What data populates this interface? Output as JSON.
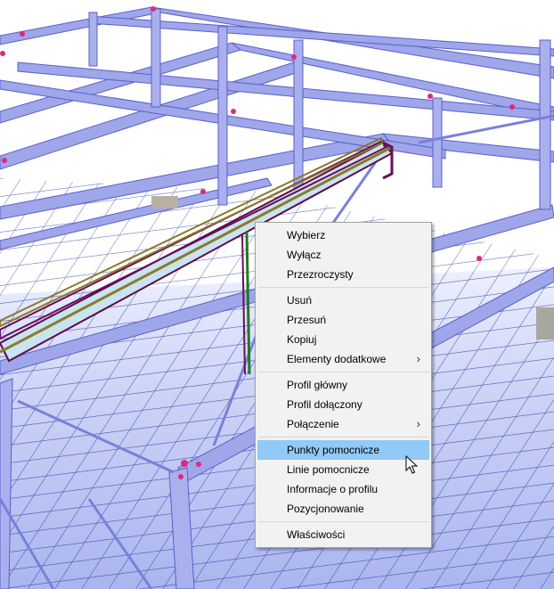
{
  "context_menu": {
    "groups": [
      [
        {
          "label": "Wybierz"
        },
        {
          "label": "Wyłącz"
        },
        {
          "label": "Przezroczysty"
        }
      ],
      [
        {
          "label": "Usuń"
        },
        {
          "label": "Przesuń"
        },
        {
          "label": "Kopiuj"
        },
        {
          "label": "Elementy dodatkowe",
          "submenu": true,
          "arrow": "›"
        }
      ],
      [
        {
          "label": "Profil główny"
        },
        {
          "label": "Profil dołączony"
        },
        {
          "label": "Połączenie",
          "submenu": true,
          "arrow": "›"
        }
      ],
      [
        {
          "label": "Punkty pomocnicze",
          "highlighted": true
        },
        {
          "label": "Linie pomocnicze"
        },
        {
          "label": "Informacje o profilu"
        },
        {
          "label": "Pozycjonowanie"
        }
      ],
      [
        {
          "label": "Właściwości"
        }
      ]
    ]
  },
  "colors": {
    "highlight": "#91c9f7",
    "beam": "#9fa6ea",
    "beam_edge": "#5a60c8",
    "grid_line": "#2d3aa8",
    "sky": "#ffffff",
    "marker": "#e0287c"
  }
}
